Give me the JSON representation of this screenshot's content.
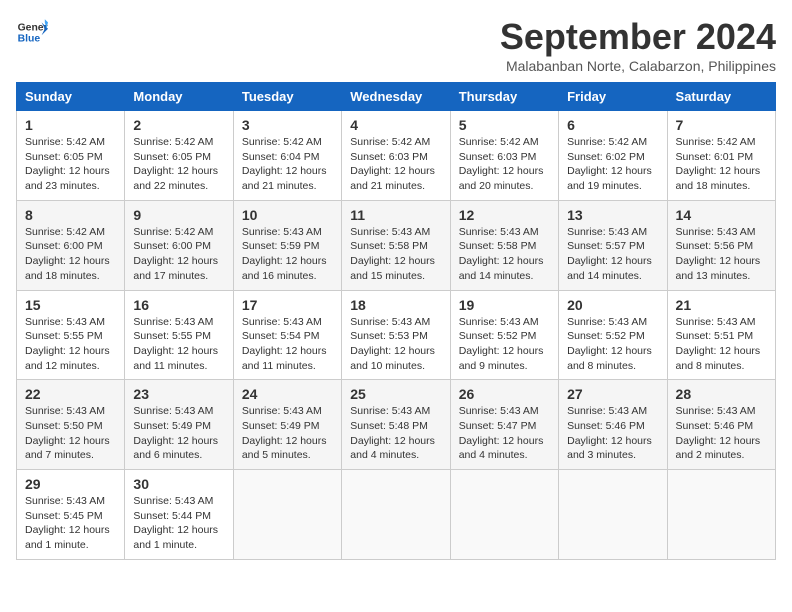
{
  "header": {
    "logo_line1": "General",
    "logo_line2": "Blue",
    "month": "September 2024",
    "location": "Malabanban Norte, Calabarzon, Philippines"
  },
  "weekdays": [
    "Sunday",
    "Monday",
    "Tuesday",
    "Wednesday",
    "Thursday",
    "Friday",
    "Saturday"
  ],
  "weeks": [
    [
      {
        "day": "1",
        "lines": [
          "Sunrise: 5:42 AM",
          "Sunset: 6:05 PM",
          "Daylight: 12 hours",
          "and 23 minutes."
        ]
      },
      {
        "day": "2",
        "lines": [
          "Sunrise: 5:42 AM",
          "Sunset: 6:05 PM",
          "Daylight: 12 hours",
          "and 22 minutes."
        ]
      },
      {
        "day": "3",
        "lines": [
          "Sunrise: 5:42 AM",
          "Sunset: 6:04 PM",
          "Daylight: 12 hours",
          "and 21 minutes."
        ]
      },
      {
        "day": "4",
        "lines": [
          "Sunrise: 5:42 AM",
          "Sunset: 6:03 PM",
          "Daylight: 12 hours",
          "and 21 minutes."
        ]
      },
      {
        "day": "5",
        "lines": [
          "Sunrise: 5:42 AM",
          "Sunset: 6:03 PM",
          "Daylight: 12 hours",
          "and 20 minutes."
        ]
      },
      {
        "day": "6",
        "lines": [
          "Sunrise: 5:42 AM",
          "Sunset: 6:02 PM",
          "Daylight: 12 hours",
          "and 19 minutes."
        ]
      },
      {
        "day": "7",
        "lines": [
          "Sunrise: 5:42 AM",
          "Sunset: 6:01 PM",
          "Daylight: 12 hours",
          "and 18 minutes."
        ]
      }
    ],
    [
      {
        "day": "8",
        "lines": [
          "Sunrise: 5:42 AM",
          "Sunset: 6:00 PM",
          "Daylight: 12 hours",
          "and 18 minutes."
        ]
      },
      {
        "day": "9",
        "lines": [
          "Sunrise: 5:42 AM",
          "Sunset: 6:00 PM",
          "Daylight: 12 hours",
          "and 17 minutes."
        ]
      },
      {
        "day": "10",
        "lines": [
          "Sunrise: 5:43 AM",
          "Sunset: 5:59 PM",
          "Daylight: 12 hours",
          "and 16 minutes."
        ]
      },
      {
        "day": "11",
        "lines": [
          "Sunrise: 5:43 AM",
          "Sunset: 5:58 PM",
          "Daylight: 12 hours",
          "and 15 minutes."
        ]
      },
      {
        "day": "12",
        "lines": [
          "Sunrise: 5:43 AM",
          "Sunset: 5:58 PM",
          "Daylight: 12 hours",
          "and 14 minutes."
        ]
      },
      {
        "day": "13",
        "lines": [
          "Sunrise: 5:43 AM",
          "Sunset: 5:57 PM",
          "Daylight: 12 hours",
          "and 14 minutes."
        ]
      },
      {
        "day": "14",
        "lines": [
          "Sunrise: 5:43 AM",
          "Sunset: 5:56 PM",
          "Daylight: 12 hours",
          "and 13 minutes."
        ]
      }
    ],
    [
      {
        "day": "15",
        "lines": [
          "Sunrise: 5:43 AM",
          "Sunset: 5:55 PM",
          "Daylight: 12 hours",
          "and 12 minutes."
        ]
      },
      {
        "day": "16",
        "lines": [
          "Sunrise: 5:43 AM",
          "Sunset: 5:55 PM",
          "Daylight: 12 hours",
          "and 11 minutes."
        ]
      },
      {
        "day": "17",
        "lines": [
          "Sunrise: 5:43 AM",
          "Sunset: 5:54 PM",
          "Daylight: 12 hours",
          "and 11 minutes."
        ]
      },
      {
        "day": "18",
        "lines": [
          "Sunrise: 5:43 AM",
          "Sunset: 5:53 PM",
          "Daylight: 12 hours",
          "and 10 minutes."
        ]
      },
      {
        "day": "19",
        "lines": [
          "Sunrise: 5:43 AM",
          "Sunset: 5:52 PM",
          "Daylight: 12 hours",
          "and 9 minutes."
        ]
      },
      {
        "day": "20",
        "lines": [
          "Sunrise: 5:43 AM",
          "Sunset: 5:52 PM",
          "Daylight: 12 hours",
          "and 8 minutes."
        ]
      },
      {
        "day": "21",
        "lines": [
          "Sunrise: 5:43 AM",
          "Sunset: 5:51 PM",
          "Daylight: 12 hours",
          "and 8 minutes."
        ]
      }
    ],
    [
      {
        "day": "22",
        "lines": [
          "Sunrise: 5:43 AM",
          "Sunset: 5:50 PM",
          "Daylight: 12 hours",
          "and 7 minutes."
        ]
      },
      {
        "day": "23",
        "lines": [
          "Sunrise: 5:43 AM",
          "Sunset: 5:49 PM",
          "Daylight: 12 hours",
          "and 6 minutes."
        ]
      },
      {
        "day": "24",
        "lines": [
          "Sunrise: 5:43 AM",
          "Sunset: 5:49 PM",
          "Daylight: 12 hours",
          "and 5 minutes."
        ]
      },
      {
        "day": "25",
        "lines": [
          "Sunrise: 5:43 AM",
          "Sunset: 5:48 PM",
          "Daylight: 12 hours",
          "and 4 minutes."
        ]
      },
      {
        "day": "26",
        "lines": [
          "Sunrise: 5:43 AM",
          "Sunset: 5:47 PM",
          "Daylight: 12 hours",
          "and 4 minutes."
        ]
      },
      {
        "day": "27",
        "lines": [
          "Sunrise: 5:43 AM",
          "Sunset: 5:46 PM",
          "Daylight: 12 hours",
          "and 3 minutes."
        ]
      },
      {
        "day": "28",
        "lines": [
          "Sunrise: 5:43 AM",
          "Sunset: 5:46 PM",
          "Daylight: 12 hours",
          "and 2 minutes."
        ]
      }
    ],
    [
      {
        "day": "29",
        "lines": [
          "Sunrise: 5:43 AM",
          "Sunset: 5:45 PM",
          "Daylight: 12 hours",
          "and 1 minute."
        ]
      },
      {
        "day": "30",
        "lines": [
          "Sunrise: 5:43 AM",
          "Sunset: 5:44 PM",
          "Daylight: 12 hours",
          "and 1 minute."
        ]
      },
      {
        "day": "",
        "lines": []
      },
      {
        "day": "",
        "lines": []
      },
      {
        "day": "",
        "lines": []
      },
      {
        "day": "",
        "lines": []
      },
      {
        "day": "",
        "lines": []
      }
    ]
  ]
}
